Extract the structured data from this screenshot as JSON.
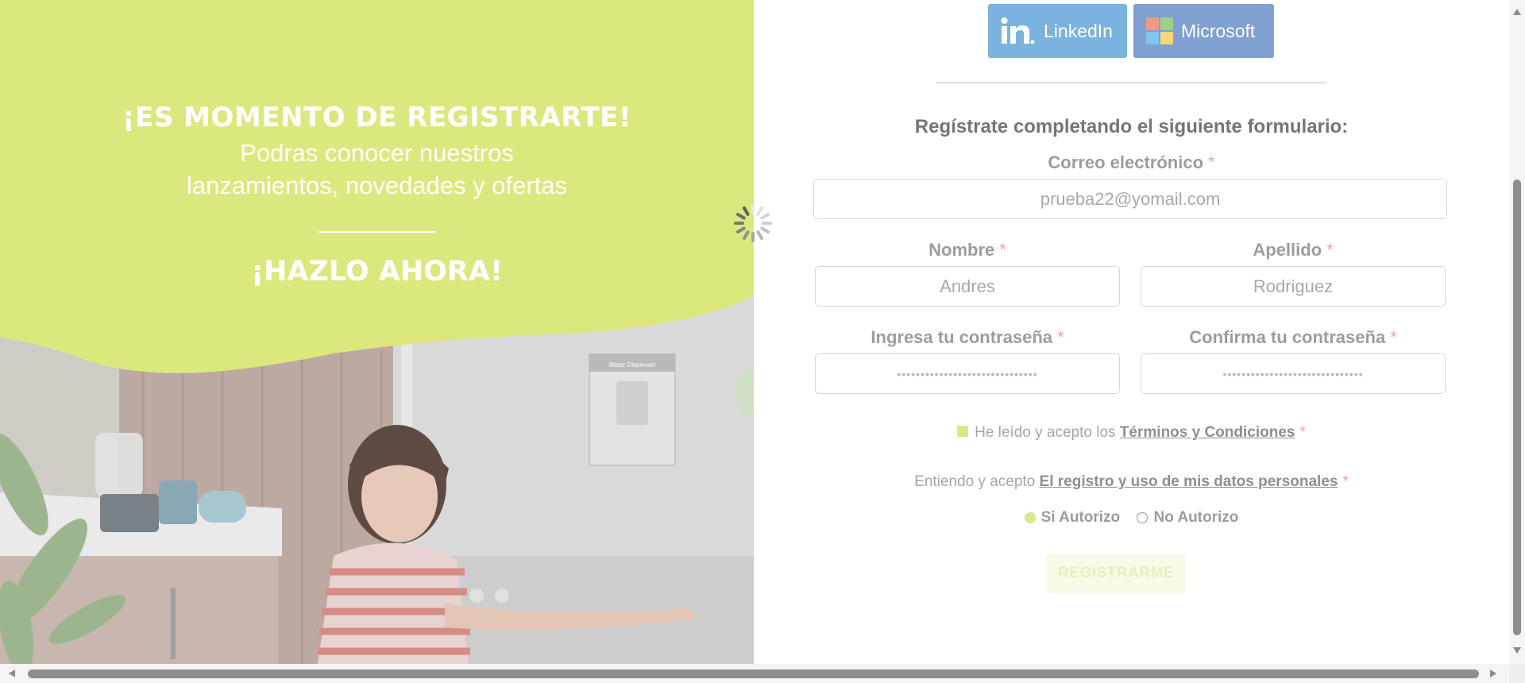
{
  "hero": {
    "headline": "¡ES MOMENTO DE REGISTRARTE!",
    "subtitle_line1": "Podras conocer nuestros",
    "subtitle_line2": "lanzamientos, novedades y ofertas",
    "cta": "¡HAZLO AHORA!",
    "fridge_label": "Water Dispenser",
    "blob_color": "#dce87e"
  },
  "oauth": {
    "linkedin_label": "LinkedIn",
    "linkedin_icon": "linkedin-logo-icon",
    "microsoft_label": "Microsoft",
    "microsoft_icon": "microsoft-logo-icon"
  },
  "form": {
    "title": "Regístrate completando el siguiente formulario:",
    "required_mark": "*",
    "email": {
      "label": "Correo electrónico",
      "value": "prueba22@yomail.com"
    },
    "first_name": {
      "label": "Nombre",
      "value": "Andres"
    },
    "last_name": {
      "label": "Apellido",
      "value": "Rodriguez"
    },
    "password": {
      "label": "Ingresa tu contraseña",
      "value": "••••••••••••••••••••••••••••••"
    },
    "confirm_password": {
      "label": "Confirma tu contraseña",
      "value": "••••••••••••••••••••••••••••••"
    },
    "terms": {
      "prefix": "He leído y acepto los",
      "link": "Términos y Condiciones",
      "checked": true
    },
    "data_policy": {
      "prefix": "Entiendo y acepto",
      "link": "El registro y uso de mis datos personales"
    },
    "authorize_options": [
      {
        "label": "Si Autorizo",
        "selected": true
      },
      {
        "label": "No Autorizo",
        "selected": false
      }
    ],
    "submit_label": "REGISTRARME"
  },
  "colors": {
    "accent": "#dce68a",
    "linkedin": "#7ab3de",
    "microsoft": "#7fa0d0"
  }
}
